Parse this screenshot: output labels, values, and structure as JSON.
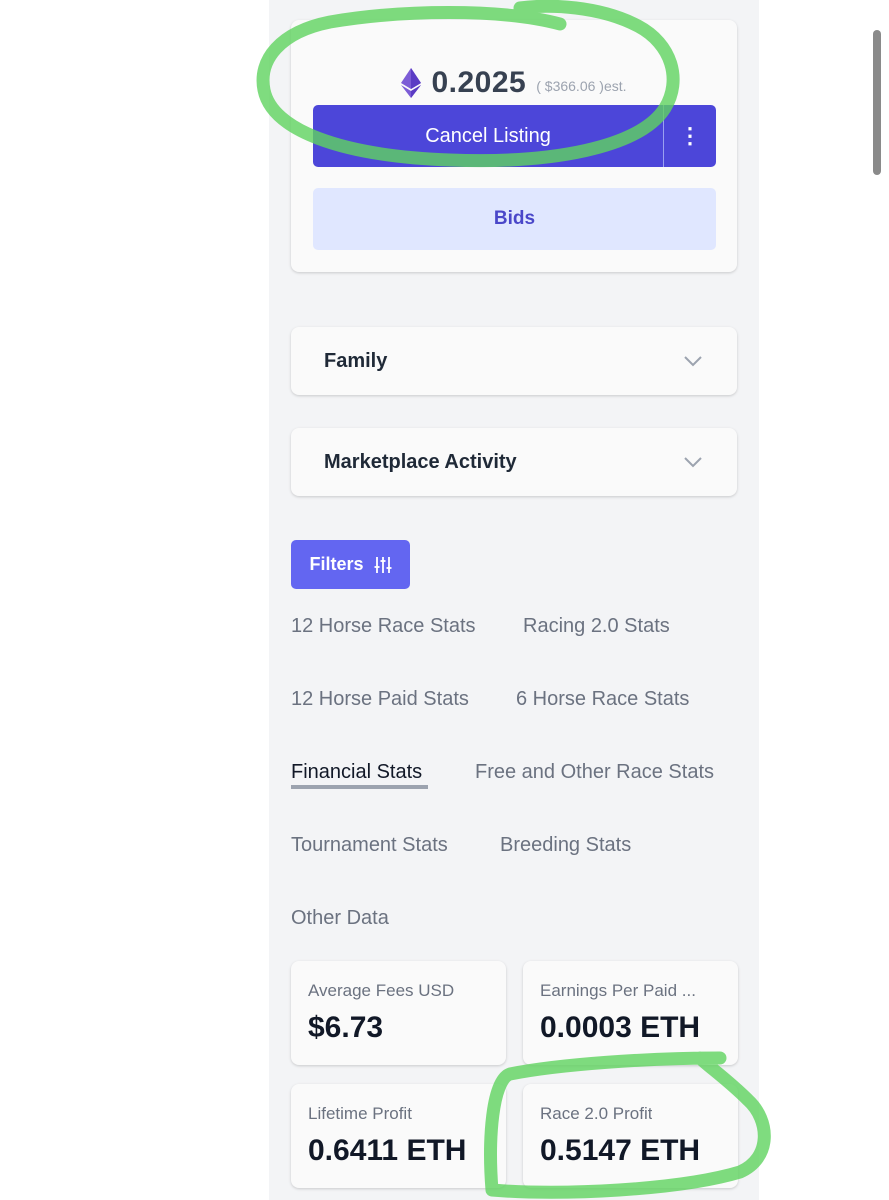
{
  "price": {
    "value": "0.2025",
    "usd_estimate": "( $366.06 )est.",
    "icon": "ethereum-icon"
  },
  "actions": {
    "cancel_label": "Cancel Listing",
    "more_label": "⋮",
    "bids_label": "Bids"
  },
  "accordions": [
    {
      "title": "Family"
    },
    {
      "title": "Marketplace Activity"
    }
  ],
  "filters": {
    "label": "Filters",
    "icon": "sliders-icon"
  },
  "tabs": [
    {
      "label": "12 Horse Race Stats"
    },
    {
      "label": "Racing 2.0 Stats"
    },
    {
      "label": "12 Horse Paid Stats"
    },
    {
      "label": "6 Horse Race Stats"
    },
    {
      "label": "Financial Stats",
      "active": true
    },
    {
      "label": "Free and Other Race Stats"
    },
    {
      "label": "Tournament Stats"
    },
    {
      "label": "Breeding Stats"
    },
    {
      "label": "Other Data"
    }
  ],
  "stats": [
    {
      "label": "Average Fees USD",
      "value": "$6.73"
    },
    {
      "label": "Earnings Per Paid ...",
      "value": "0.0003 ETH"
    },
    {
      "label": "Lifetime Profit",
      "value": "0.6411 ETH"
    },
    {
      "label": "Race 2.0 Profit",
      "value": "0.5147 ETH"
    }
  ],
  "colors": {
    "primary": "#4c46d9",
    "filters": "#6366f1",
    "bids_bg": "#e0e7ff",
    "highlight_marker": "#5fd35f"
  }
}
